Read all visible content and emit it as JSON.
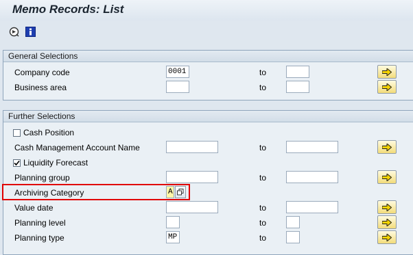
{
  "window": {
    "title": "Memo Records: List"
  },
  "toolbar": {
    "icons": [
      "execute-icon",
      "info-icon"
    ]
  },
  "general_selections": {
    "header": "General Selections",
    "rows": [
      {
        "label": "Company code",
        "from": "0001",
        "to_label": "to",
        "to": ""
      },
      {
        "label": "Business area",
        "from": "",
        "to_label": "to",
        "to": ""
      }
    ]
  },
  "further_selections": {
    "header": "Further Selections",
    "cash_position": {
      "label": "Cash Position",
      "checked": false
    },
    "cash_mgmt_account": {
      "label": "Cash Management Account Name",
      "from": "",
      "to_label": "to",
      "to": ""
    },
    "liquidity_forecast": {
      "label": "Liquidity Forecast",
      "checked": true
    },
    "planning_group": {
      "label": "Planning group",
      "from": "",
      "to_label": "to",
      "to": ""
    },
    "archiving_category": {
      "label": "Archiving Category",
      "value": "A"
    },
    "value_date": {
      "label": "Value date",
      "from": "",
      "to_label": "to",
      "to": ""
    },
    "planning_level": {
      "label": "Planning level",
      "from": "",
      "to_label": "to",
      "to": ""
    },
    "planning_type": {
      "label": "Planning type",
      "from": "MP",
      "to_label": "to",
      "to": ""
    }
  },
  "colors": {
    "highlight": "#e00000",
    "multi_button": "#f3dc7a"
  }
}
